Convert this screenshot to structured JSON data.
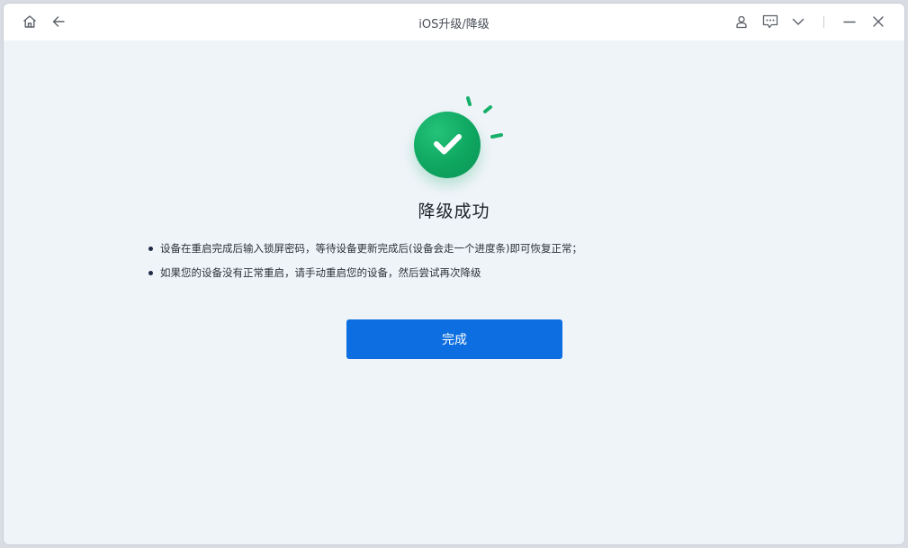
{
  "window": {
    "title": "iOS升级/降级"
  },
  "titlebar": {
    "left_icons": [
      "home-icon",
      "back-arrow-icon"
    ],
    "right_icons": [
      "user-icon",
      "feedback-icon",
      "chevron-down-icon",
      "minimize-icon",
      "close-icon"
    ]
  },
  "main": {
    "status_icon": "check-circle-icon",
    "heading": "降级成功",
    "instructions": [
      "设备在重启完成后输入锁屏密码，等待设备更新完成后(设备会走一个进度条)即可恢复正常；",
      "如果您的设备没有正常重启，请手动重启您的设备，然后尝试再次降级"
    ],
    "done_button_label": "完成"
  },
  "colors": {
    "accent": "#0c6ee0",
    "success": "#0ea660",
    "background": "#eff4f9"
  }
}
